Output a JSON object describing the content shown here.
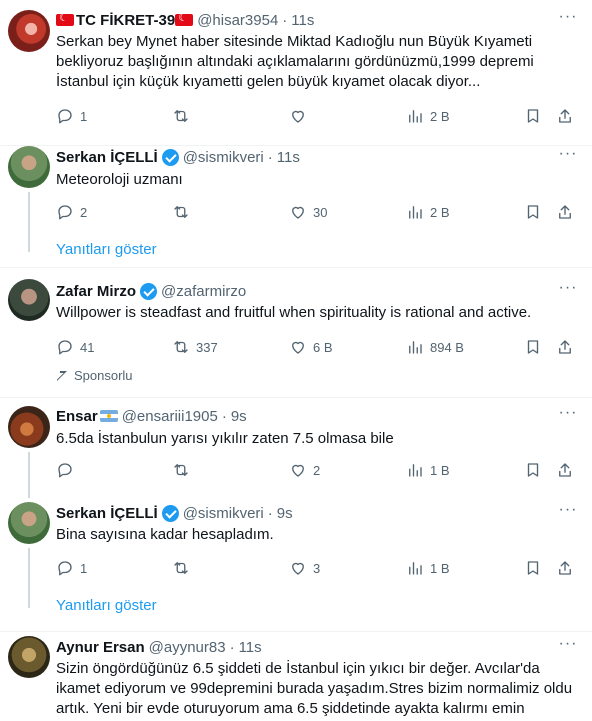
{
  "tweets": [
    {
      "display_name": "TC FİKRET-39",
      "handle": "@hisar3954",
      "time": "11s",
      "text": "Serkan bey Mynet haber sitesinde Miktad Kadıoğlu nun Büyük Kıyameti bekliyoruz başlığının altındaki açıklamalarını gördünüzmü,1999 depremi İstanbul için küçük kıyametti gelen büyük kıyamet olacak diyor...",
      "replies": "1",
      "retweets": "",
      "likes": "",
      "views": "2 B"
    },
    {
      "display_name": "Serkan İÇELLİ",
      "handle": "@sismikveri",
      "time": "11s",
      "text": "Meteoroloji uzmanı",
      "replies": "2",
      "retweets": "",
      "likes": "30",
      "views": "2 B",
      "show_replies": "Yanıtları göster"
    },
    {
      "display_name": "Zafar Mirzo",
      "handle": "@zafarmirzo",
      "time": "",
      "text": "Willpower is steadfast and fruitful when spirituality is rational and active.",
      "replies": "41",
      "retweets": "337",
      "likes": "6 B",
      "views": "894 B",
      "promoted_label": "Sponsorlu"
    },
    {
      "display_name": "Ensar",
      "handle": "@ensariii1905",
      "time": "9s",
      "text": "6.5da İstanbulun yarısı yıkılır zaten 7.5 olmasa bile",
      "replies": "",
      "retweets": "",
      "likes": "2",
      "views": "1 B"
    },
    {
      "display_name": "Serkan İÇELLİ",
      "handle": "@sismikveri",
      "time": "9s",
      "text": "Bina sayısına kadar hesapladım.",
      "replies": "1",
      "retweets": "",
      "likes": "3",
      "views": "1 B",
      "show_replies": "Yanıtları göster"
    },
    {
      "display_name": "Aynur Ersan",
      "handle": "@ayynur83",
      "time": "11s",
      "text": "Sizin öngördüğünüz 6.5 şiddeti de İstanbul için yıkıcı bir değer. Avcılar'da ikamet ediyorum ve 99depremini burada yaşadım.Stres bizim normalimiz oldu artık. Yeni bir evde oturuyorum ama 6.5 şiddetinde ayakta kalırmı emin"
    }
  ],
  "colors": {
    "accent": "#1d9bf0",
    "muted": "#536471",
    "separator": "#eff3f4"
  },
  "icons": [
    "reply-icon",
    "retweet-icon",
    "like-icon",
    "views-icon",
    "bookmark-icon",
    "share-icon",
    "more-icon",
    "verified-badge-icon",
    "turkey-flag-icon",
    "argentina-flag-icon",
    "promoted-icon"
  ]
}
